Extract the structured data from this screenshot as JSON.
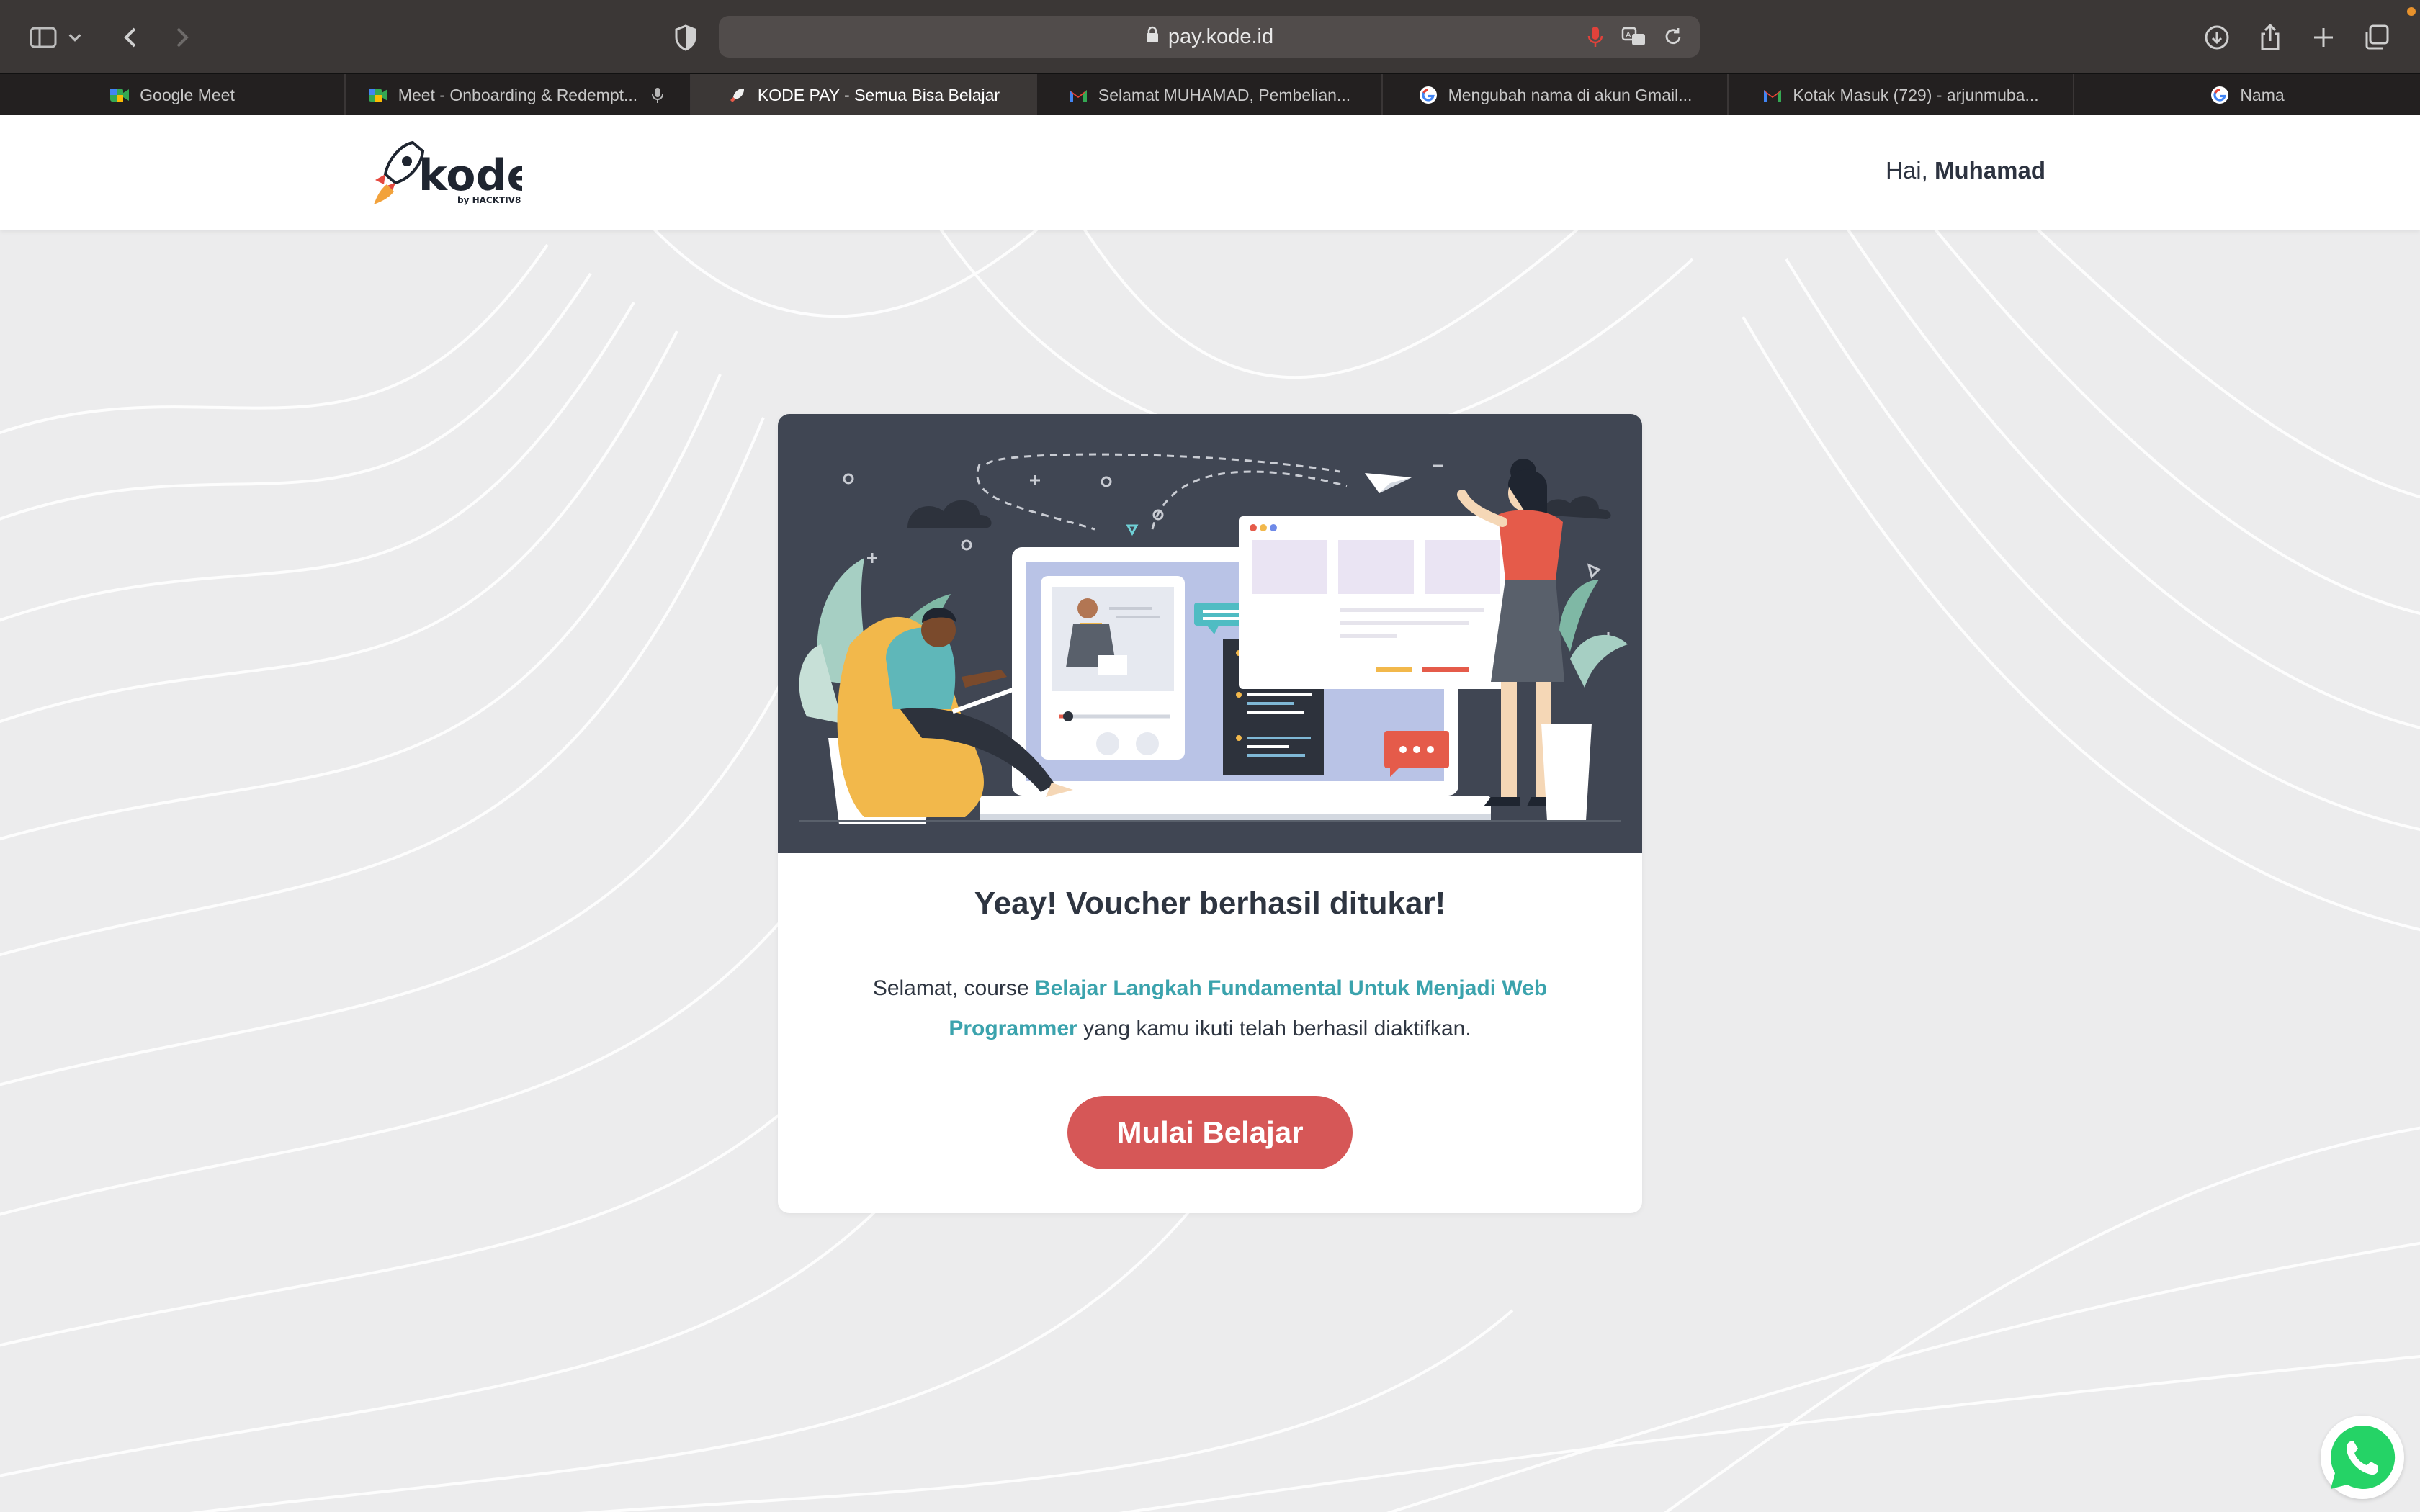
{
  "browser": {
    "url": "pay.kode.id",
    "tabs": [
      {
        "label": "Google Meet",
        "favicon": "google-meet-icon"
      },
      {
        "label": "Meet - Onboarding & Redempt...",
        "favicon": "google-meet-icon"
      },
      {
        "label": "KODE PAY - Semua Bisa Belajar",
        "favicon": "kode-rocket-icon",
        "active": true
      },
      {
        "label": "Selamat MUHAMAD, Pembelian...",
        "favicon": "gmail-icon"
      },
      {
        "label": "Mengubah nama di akun Gmail...",
        "favicon": "google-icon"
      },
      {
        "label": "Kotak Masuk (729) - arjunmuba...",
        "favicon": "gmail-icon"
      },
      {
        "label": "Nama",
        "favicon": "google-icon"
      }
    ]
  },
  "header": {
    "logo_text": "kode",
    "logo_sub": "by HACKTIV8",
    "greeting_prefix": "Hai,",
    "user_name": "Muhamad"
  },
  "card": {
    "title": "Yeay! Voucher berhasil ditukar!",
    "body_prefix": "Selamat, course",
    "course_name": "Belajar Langkah Fundamental Untuk Menjadi Web Programmer",
    "body_suffix": "yang kamu ikuti telah berhasil diaktifkan.",
    "cta_label": "Mulai Belajar"
  },
  "colors": {
    "accent": "#d65757",
    "link": "#3ba3ad",
    "hero_bg": "#404653",
    "page_bg": "#ececed"
  }
}
